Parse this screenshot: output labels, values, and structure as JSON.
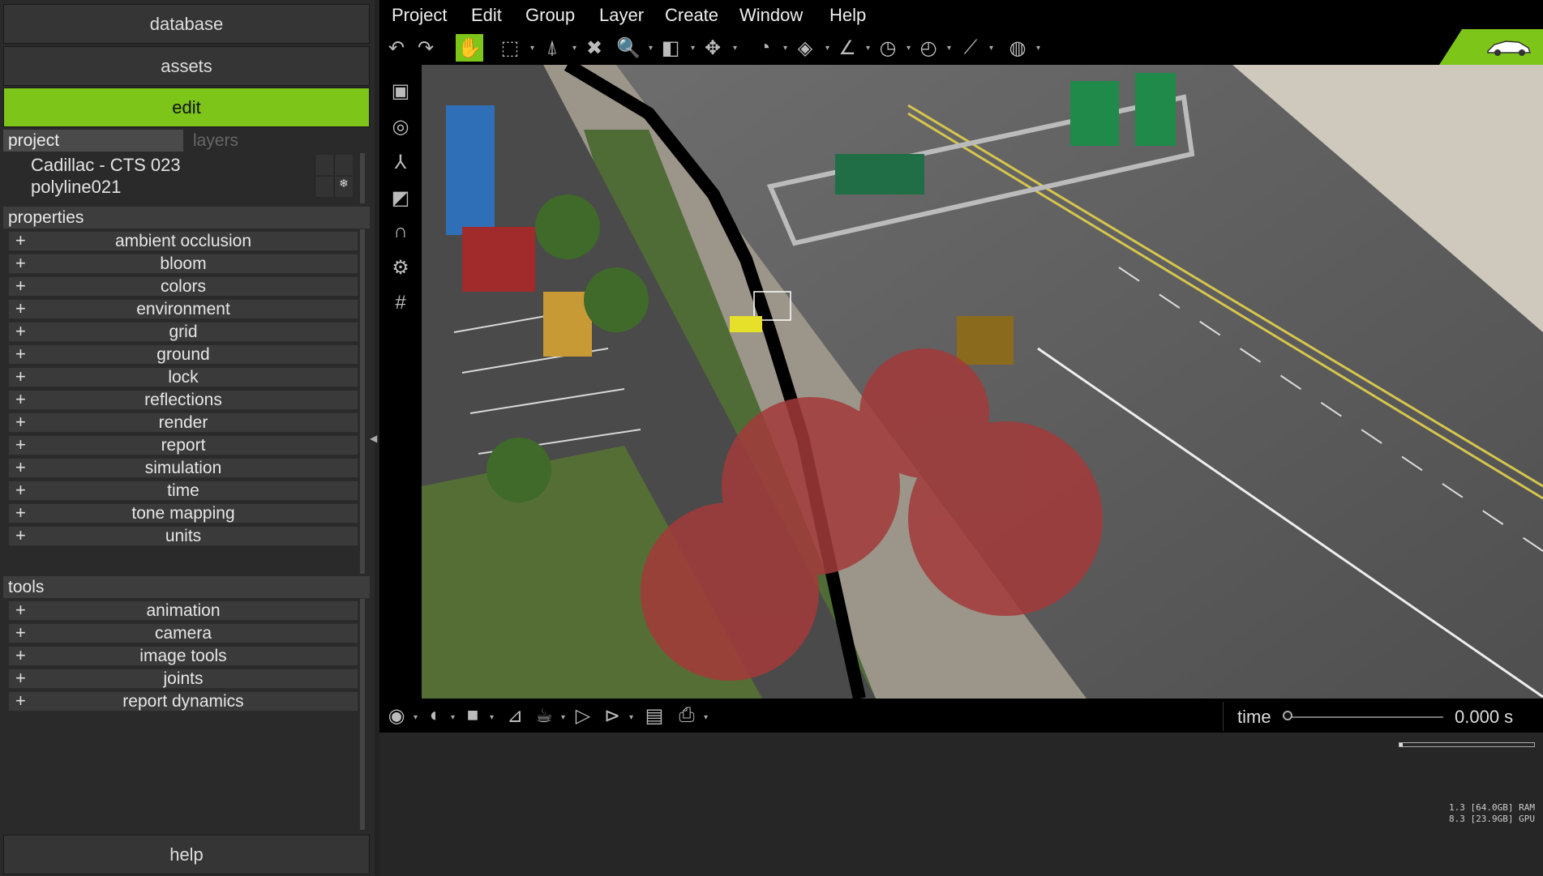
{
  "left_panel": {
    "buttons": {
      "database": "database",
      "assets": "assets",
      "edit": "edit",
      "help": "help"
    },
    "tabs": {
      "project": "project",
      "layers": "layers"
    },
    "project_items": [
      "Cadillac - CTS 023",
      "polyline021"
    ],
    "properties": {
      "title": "properties",
      "items": [
        "ambient occlusion",
        "bloom",
        "colors",
        "environment",
        "grid",
        "ground",
        "lock",
        "reflections",
        "render",
        "report",
        "simulation",
        "time",
        "tone mapping",
        "units"
      ]
    },
    "tools": {
      "title": "tools",
      "items": [
        "animation",
        "camera",
        "image tools",
        "joints",
        "report dynamics"
      ]
    },
    "expand_glyph": "+"
  },
  "menubar": [
    "Project",
    "Edit",
    "Group",
    "Layer",
    "Create",
    "Window",
    "Help"
  ],
  "toolbar_icons": [
    "undo-icon",
    "redo-icon",
    "hand-pan-icon",
    "select-box-icon",
    "tripod-icon",
    "delete-icon",
    "zoom-icon",
    "cube-icon",
    "move-icon",
    "measure-dial-icon",
    "plane-icon",
    "angle-icon",
    "speed-dial-icon",
    "timer-icon",
    "ruler-icon",
    "sphere-icon"
  ],
  "timeline": {
    "label": "time",
    "value": "0.000 s",
    "position": 0
  },
  "memory": {
    "ram": "1.3 [64.0GB] RAM",
    "gpu": "8.3 [23.9GB] GPU"
  },
  "colors": {
    "accent": "#7ec51a",
    "panel": "#2a2a2a",
    "toolbar": "#000000"
  }
}
